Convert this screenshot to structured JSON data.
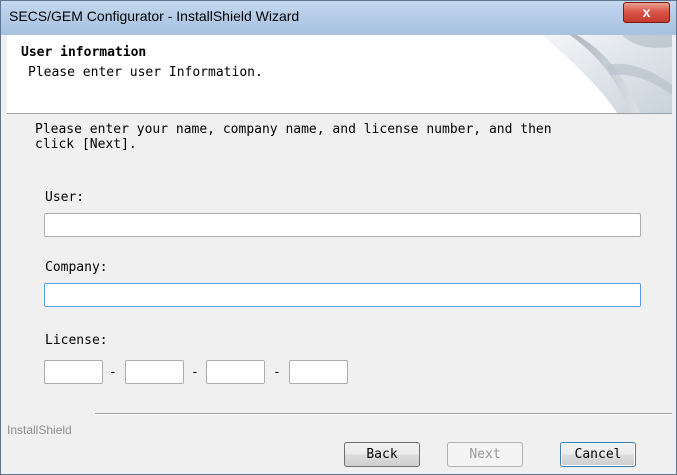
{
  "window": {
    "title": "SECS/GEM Configurator - InstallShield Wizard",
    "close_glyph": "x"
  },
  "header": {
    "title": "User information",
    "subtitle": "Please enter user Information."
  },
  "instructions": {
    "line1": "Please enter your name, company name, and license number, and then",
    "line2": "click [Next]."
  },
  "form": {
    "user_label": "User:",
    "user_value": "",
    "company_label": "Company:",
    "company_value": "",
    "license_label": "License:",
    "license_parts": [
      "",
      "",
      "",
      ""
    ],
    "dash": "-"
  },
  "footer": {
    "brand": "InstallShield",
    "back_label": "Back",
    "next_label": "Next",
    "cancel_label": "Cancel"
  },
  "colors": {
    "focus_border": "#569de5",
    "close_red": "#c43a2c"
  }
}
